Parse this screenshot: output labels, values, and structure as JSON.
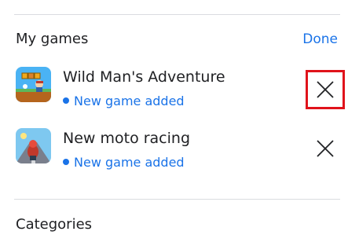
{
  "section": {
    "title": "My games",
    "done_label": "Done"
  },
  "games": [
    {
      "title": "Wild Man's Adventure",
      "status": "New game added",
      "icon": "wild-man-adventure-thumbnail",
      "remove_icon": "close-icon",
      "remove_highlighted": true
    },
    {
      "title": "New moto racing",
      "status": "New game added",
      "icon": "moto-racing-thumbnail",
      "remove_icon": "close-icon",
      "remove_highlighted": false
    }
  ],
  "next_section": {
    "title": "Categories"
  },
  "colors": {
    "accent": "#1a73e8",
    "highlight": "#e0131b",
    "text": "#202124",
    "divider": "#dadce0"
  }
}
